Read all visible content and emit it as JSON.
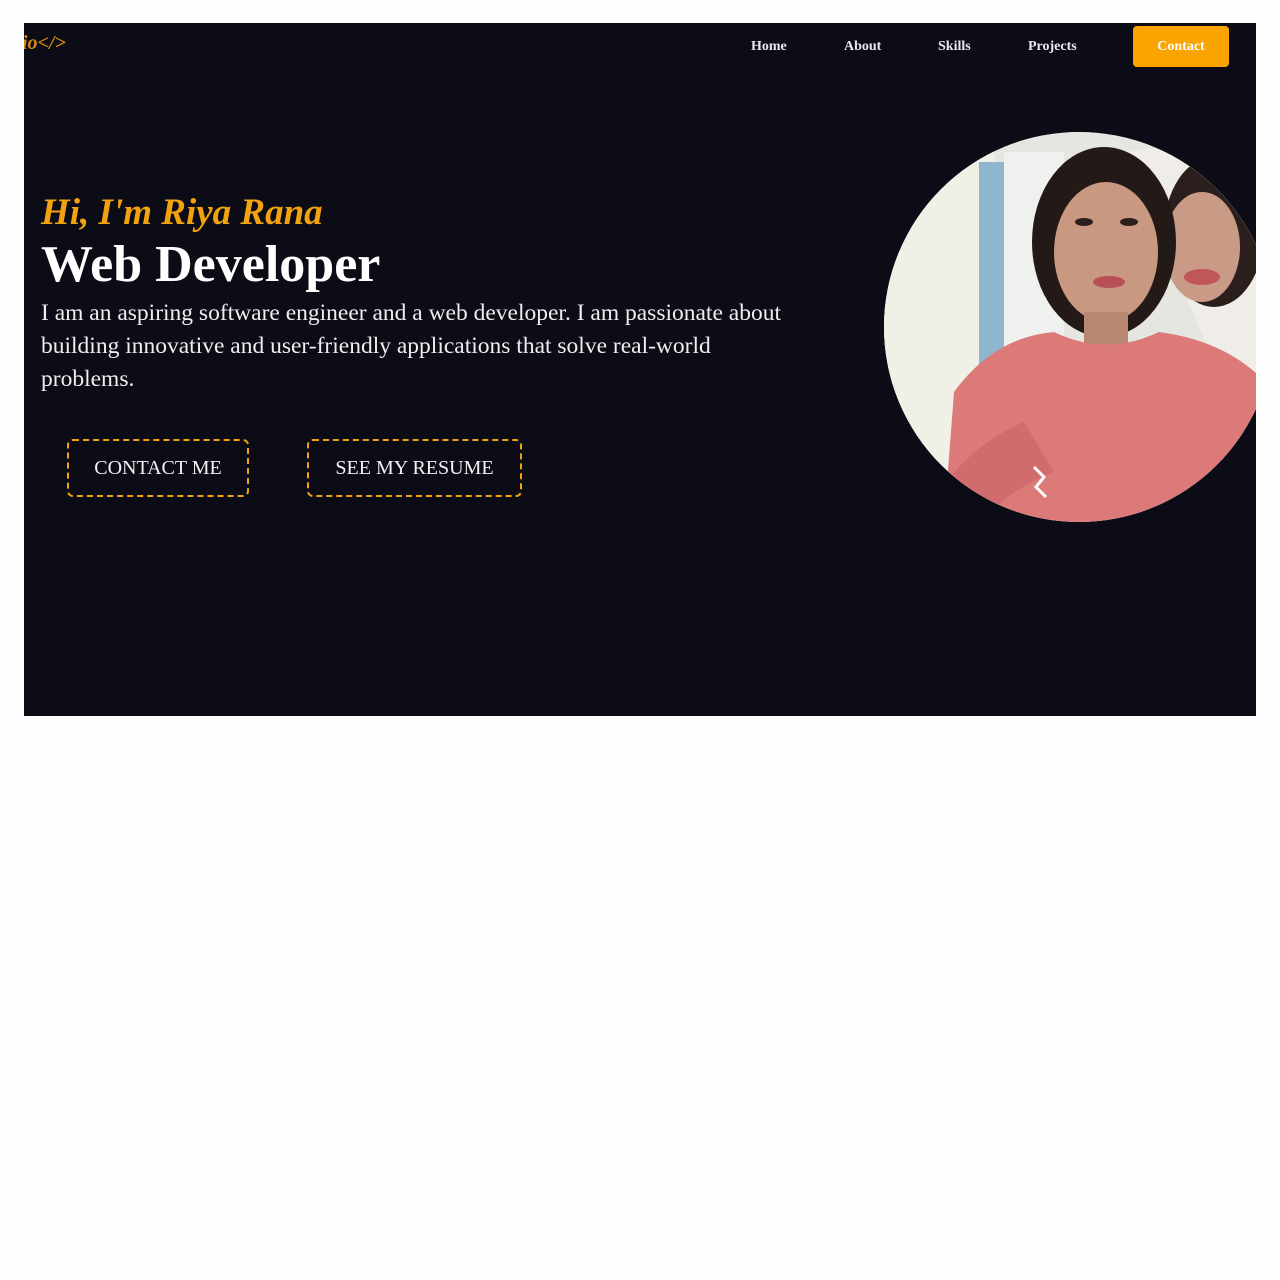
{
  "header": {
    "logo_text": "io</>",
    "nav": [
      {
        "label": "Home"
      },
      {
        "label": "About"
      },
      {
        "label": "Skills"
      },
      {
        "label": "Projects"
      }
    ],
    "contact_label": "Contact"
  },
  "hero": {
    "greeting": "Hi, I'm Riya Rana",
    "role": "Web Developer",
    "bio": "I am an aspiring software engineer and a web developer. I am passionate about building innovative and user-friendly applications that solve real-world problems.",
    "buttons": {
      "contact_me": "CONTACT ME",
      "resume": "SEE MY RESUME"
    }
  },
  "colors": {
    "background": "#0b0c16",
    "accent": "#f2a20f",
    "contact_button": "#f9a400",
    "text": "#ffffff"
  },
  "icons": {
    "profile_photo": "profile-photo"
  }
}
